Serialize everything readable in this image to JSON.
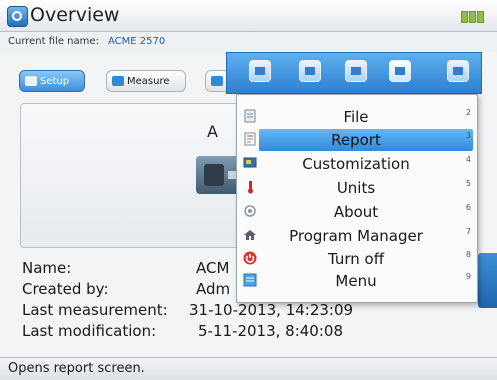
{
  "window": {
    "title": "Overview"
  },
  "file": {
    "label": "Current file name:",
    "value": "ACME 2570"
  },
  "toolbar": {
    "setup_label": "Setup",
    "measure_label": "Measure"
  },
  "panel": {
    "title": "A"
  },
  "info": {
    "rows": [
      {
        "key": "Name:",
        "value": "ACM"
      },
      {
        "key": "Created by:",
        "value": "Adm"
      },
      {
        "key": "Last measurement:",
        "value": "31-10-2013, 14:23:09"
      },
      {
        "key": "Last modification:",
        "value": "5-11-2013, 8:40:08"
      }
    ]
  },
  "menu": {
    "items": [
      {
        "label": "File",
        "number": "2",
        "icon": "file-icon",
        "selected": false
      },
      {
        "label": "Report",
        "number": "3",
        "icon": "report-icon",
        "selected": true
      },
      {
        "label": "Customization",
        "number": "4",
        "icon": "customization-icon",
        "selected": false
      },
      {
        "label": "Units",
        "number": "5",
        "icon": "thermometer-icon",
        "selected": false
      },
      {
        "label": "About",
        "number": "6",
        "icon": "about-icon",
        "selected": false
      },
      {
        "label": "Program Manager",
        "number": "7",
        "icon": "home-icon",
        "selected": false
      },
      {
        "label": "Turn off",
        "number": "8",
        "icon": "power-icon",
        "selected": false
      },
      {
        "label": "Menu",
        "number": "9",
        "icon": "menu-icon",
        "selected": false
      }
    ]
  },
  "status": {
    "text": "Opens report screen."
  },
  "colors": {
    "accent": "#2f89dc",
    "selected_item": "#66b8f4",
    "power": "#d9332a"
  }
}
